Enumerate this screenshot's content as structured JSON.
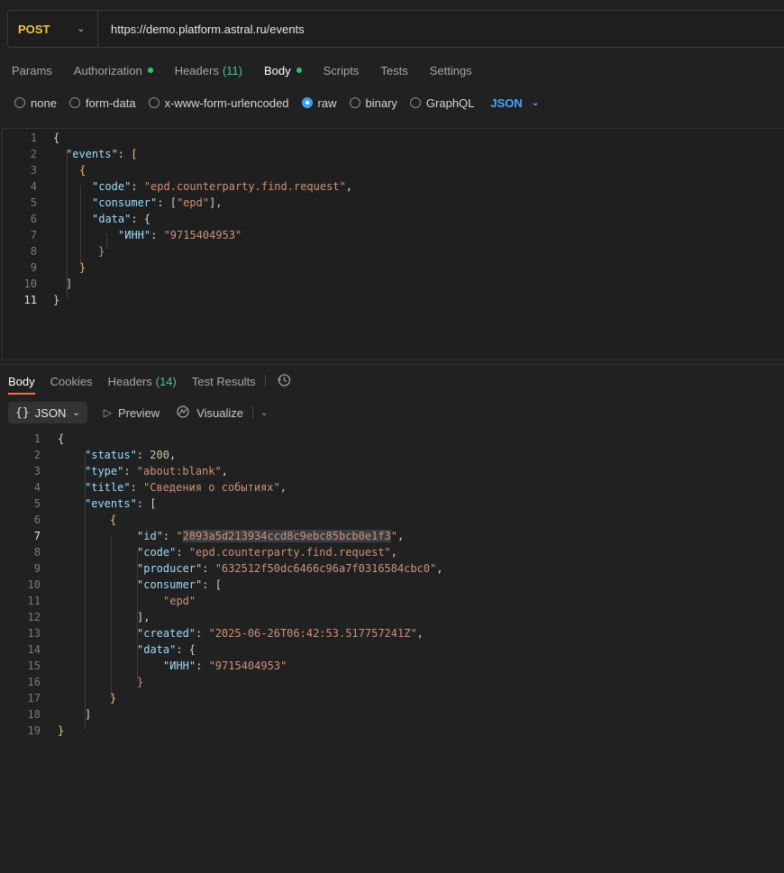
{
  "request": {
    "method": "POST",
    "url": "https://demo.platform.astral.ru/events"
  },
  "request_tabs": {
    "params": "Params",
    "authorization": "Authorization",
    "headers": "Headers",
    "headers_count": "(11)",
    "body": "Body",
    "scripts": "Scripts",
    "tests": "Tests",
    "settings": "Settings"
  },
  "body_types": {
    "none": "none",
    "form_data": "form-data",
    "urlencoded": "x-www-form-urlencoded",
    "raw": "raw",
    "binary": "binary",
    "graphql": "GraphQL",
    "language": "JSON"
  },
  "request_body": {
    "line_numbers": [
      "1",
      "2",
      "3",
      "4",
      "5",
      "6",
      "7",
      "8",
      "9",
      "10",
      "11"
    ],
    "key_events": "\"events\"",
    "key_code": "\"code\"",
    "val_code": "\"epd.counterparty.find.request\"",
    "key_consumer": "\"consumer\"",
    "val_consumer": "\"epd\"",
    "key_data": "\"data\"",
    "key_inn": "\"ИНН\"",
    "val_inn": "\"9715404953\""
  },
  "response_tabs": {
    "body": "Body",
    "cookies": "Cookies",
    "headers": "Headers",
    "headers_count": "(14)",
    "test_results": "Test Results"
  },
  "response_toolbar": {
    "format": "JSON",
    "preview": "Preview",
    "visualize": "Visualize"
  },
  "response_body": {
    "line_numbers": [
      "1",
      "2",
      "3",
      "4",
      "5",
      "6",
      "7",
      "8",
      "9",
      "10",
      "11",
      "12",
      "13",
      "14",
      "15",
      "16",
      "17",
      "18",
      "19"
    ],
    "key_status": "\"status\"",
    "val_status": "200",
    "key_type": "\"type\"",
    "val_type": "\"about:blank\"",
    "key_title": "\"title\"",
    "val_title": "\"Сведения о событиях\"",
    "key_events": "\"events\"",
    "key_id": "\"id\"",
    "val_id": "2893a5d213934ccd8c9ebc85bcb0e1f3",
    "key_code": "\"code\"",
    "val_code": "\"epd.counterparty.find.request\"",
    "key_producer": "\"producer\"",
    "val_producer": "\"632512f50dc6466c96a7f0316584cbc0\"",
    "key_consumer": "\"consumer\"",
    "val_consumer": "\"epd\"",
    "key_created": "\"created\"",
    "val_created": "\"2025-06-26T06:42:53.517757241Z\"",
    "key_data": "\"data\"",
    "key_inn": "\"ИНН\"",
    "val_inn": "\"9715404953\""
  }
}
